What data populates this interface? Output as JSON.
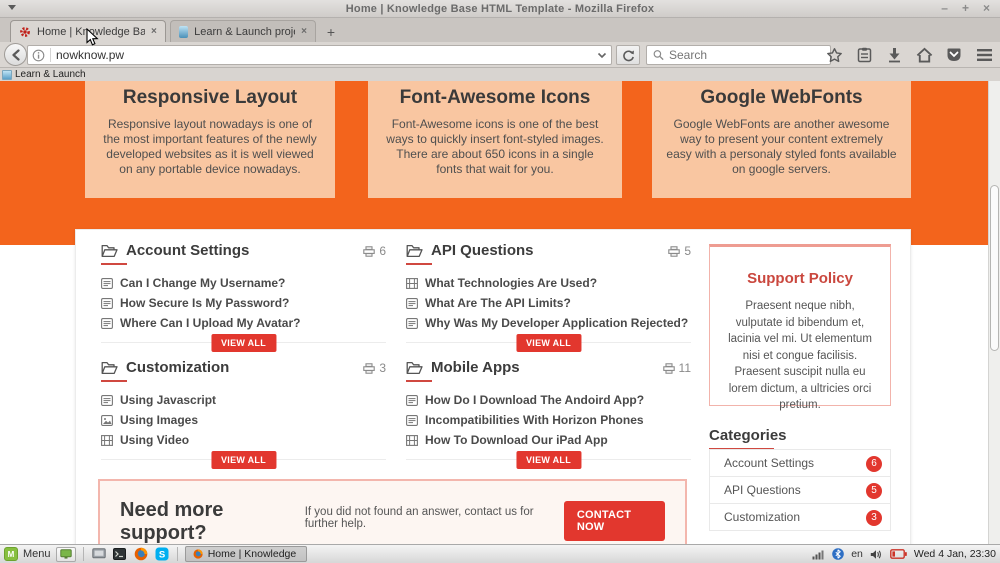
{
  "window": {
    "title": "Home | Knowledge Base HTML Template - Mozilla Firefox",
    "controls": {
      "minimize": "–",
      "maximize": "+",
      "close": "×"
    }
  },
  "browser": {
    "tabs": [
      {
        "title": "Home | Knowledge Base ...",
        "close": "×",
        "active": true
      },
      {
        "title": "Learn & Launch project - ...",
        "close": "×",
        "active": false
      }
    ],
    "new_tab_label": "+",
    "url": "nowknow.pw",
    "search_placeholder": "Search",
    "toolbar_icons": [
      "back-icon",
      "reload-icon",
      "bookmark-star-icon",
      "reading-list-icon",
      "downloads-icon",
      "home-icon",
      "pocket-icon",
      "menu-icon"
    ]
  },
  "bookmarks_bar": {
    "items": [
      {
        "label": "Learn & Launch"
      }
    ]
  },
  "page": {
    "features": [
      {
        "title": "Responsive Layout",
        "text": "Responsive layout nowadays is one of the most important features of the newly developed websites as it is well viewed on any portable device nowadays."
      },
      {
        "title": "Font-Awesome Icons",
        "text": "Font-Awesome icons is one of the best ways to quickly insert font-styled images. There are about 650 icons in a single fonts that wait for you."
      },
      {
        "title": "Google WebFonts",
        "text": "Google WebFonts are another awesome way to present your content extremely easy with a personaly styled fonts available on google servers."
      }
    ],
    "sections": [
      {
        "title": "Account Settings",
        "count": "6",
        "view_all": "VIEW ALL",
        "items": [
          {
            "icon": "article",
            "label": "Can I Change My Username?"
          },
          {
            "icon": "article",
            "label": "How Secure Is My Password?"
          },
          {
            "icon": "article",
            "label": "Where Can I Upload My Avatar?"
          }
        ]
      },
      {
        "title": "API Questions",
        "count": "5",
        "view_all": "VIEW ALL",
        "items": [
          {
            "icon": "film",
            "label": "What Technologies Are Used?"
          },
          {
            "icon": "article",
            "label": "What Are The API Limits?"
          },
          {
            "icon": "article",
            "label": "Why Was My Developer Application Rejected?"
          }
        ]
      },
      {
        "title": "Customization",
        "count": "3",
        "view_all": "VIEW ALL",
        "items": [
          {
            "icon": "article",
            "label": "Using Javascript"
          },
          {
            "icon": "image",
            "label": "Using Images"
          },
          {
            "icon": "film",
            "label": "Using Video"
          }
        ]
      },
      {
        "title": "Mobile Apps",
        "count": "11",
        "view_all": "VIEW ALL",
        "items": [
          {
            "icon": "article",
            "label": "How Do I Download The Andoird App?"
          },
          {
            "icon": "article",
            "label": "Incompatibilities With Horizon Phones"
          },
          {
            "icon": "film",
            "label": "How To Download Our iPad App"
          }
        ]
      }
    ],
    "support_policy": {
      "title": "Support Policy",
      "text": "Praesent neque nibh, vulputate id bibendum et, lacinia vel mi. Ut elementum nisi et congue facilisis. Praesent suscipit nulla eu lorem dictum, a ultricies orci pretium."
    },
    "categories": {
      "title": "Categories",
      "items": [
        {
          "label": "Account Settings",
          "count": "6"
        },
        {
          "label": "API Questions",
          "count": "5"
        },
        {
          "label": "Customization",
          "count": "3"
        }
      ]
    },
    "contact": {
      "headline": "Need more support?",
      "text": "If you did not found an answer, contact us for further help.",
      "button": "CONTACT NOW"
    }
  },
  "taskbar": {
    "menu_label": "Menu",
    "task_button": "Home | Knowledge B...",
    "tray": {
      "language": "en",
      "clock": "Wed 4 Jan, 23:30"
    }
  },
  "colors": {
    "accent_orange": "#f3641c",
    "feature_peach": "#f9c6a1",
    "action_red": "#e2372e",
    "support_title_red": "#ca473e",
    "support_border": "#f2b3ab"
  }
}
